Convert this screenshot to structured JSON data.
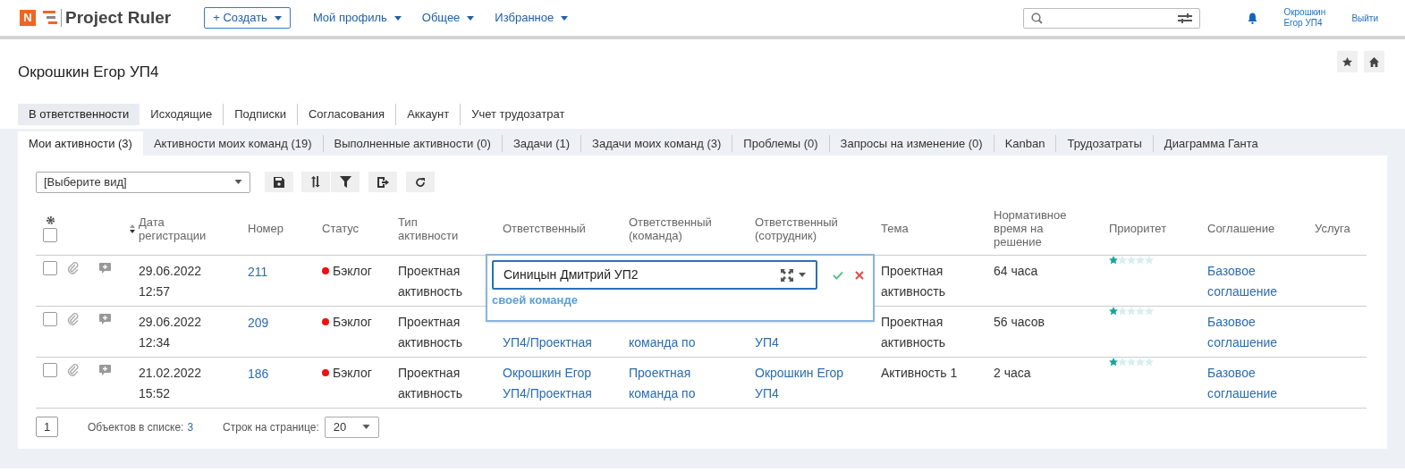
{
  "header": {
    "logo_letter": "N",
    "app_name": "Project Ruler",
    "create_button": "+ Создать",
    "menu": [
      {
        "label": "Мой профиль"
      },
      {
        "label": "Общее"
      },
      {
        "label": "Избранное"
      }
    ],
    "user": "Окрошкин Егор УП4",
    "logout": "Выйти"
  },
  "page_title": "Окрошкин Егор УП4",
  "tabs": [
    {
      "label": "В ответственности",
      "selected": true
    },
    {
      "label": "Исходящие",
      "selected": false
    },
    {
      "label": "Подписки",
      "selected": false
    },
    {
      "label": "Согласования",
      "selected": false
    },
    {
      "label": "Аккаунт",
      "selected": false
    },
    {
      "label": "Учет трудозатрат",
      "selected": false
    }
  ],
  "subtabs": [
    {
      "label": "Мои активности (3)",
      "selected": true
    },
    {
      "label": "Активности моих команд (19)",
      "selected": false
    },
    {
      "label": "Выполненные активности (0)",
      "selected": false
    },
    {
      "label": "Задачи (1)",
      "selected": false
    },
    {
      "label": "Задачи моих команд (3)",
      "selected": false
    },
    {
      "label": "Проблемы (0)",
      "selected": false
    },
    {
      "label": "Запросы на изменение (0)",
      "selected": false
    },
    {
      "label": "Kanban",
      "selected": false
    },
    {
      "label": "Трудозатраты",
      "selected": false
    },
    {
      "label": "Диаграмма Ганта",
      "selected": false
    }
  ],
  "view_select": {
    "value": "[Выберите вид]"
  },
  "table": {
    "select_all_checked": false,
    "columns": [
      "Дата регистрации",
      "Номер",
      "Статус",
      "Тип активности",
      "Ответственный",
      "Ответственный (команда)",
      "Ответственный (сотрудник)",
      "Тема",
      "Нормативное время на решение",
      "Приоритет",
      "Соглашение",
      "Услуга"
    ],
    "rows": [
      {
        "checked": false,
        "date": "29.06.2022 12:57",
        "number": "211",
        "status": "Бэклог",
        "type": "Проектная активность",
        "theme": "Проектная активность",
        "norm_time": "64 часа",
        "stars": 1,
        "agreement": "Базовое соглашение"
      },
      {
        "checked": false,
        "date": "29.06.2022 12:34",
        "number": "209",
        "status": "Бэклог",
        "type": "Проектная активность",
        "responsible": "УП4/Проектная",
        "responsible_team": "команда по",
        "responsible_employee": "УП4",
        "partly_hidden": true,
        "theme": "Проектная активность",
        "norm_time": "56 часов",
        "stars": 1,
        "agreement": "Базовое соглашение"
      },
      {
        "checked": false,
        "date": "21.02.2022 15:52",
        "number": "186",
        "status": "Бэклог",
        "type": "Проектная активность",
        "responsible": "Окрошкин Егор УП4/Проектная",
        "responsible_team": "Проектная команда по",
        "responsible_employee": "Окрошкин Егор УП4",
        "partly_hidden": false,
        "theme": "Активность 1",
        "norm_time": "2 часа",
        "stars": 1,
        "agreement": "Базовое соглашение"
      }
    ]
  },
  "editor": {
    "value": "Синицын Дмитрий УП2",
    "link": "своей команде"
  },
  "footer": {
    "page": "1",
    "count_label": "Объектов в списке:",
    "count": "3",
    "rows_label": "Строк на странице:",
    "rows_per_page": "20"
  }
}
